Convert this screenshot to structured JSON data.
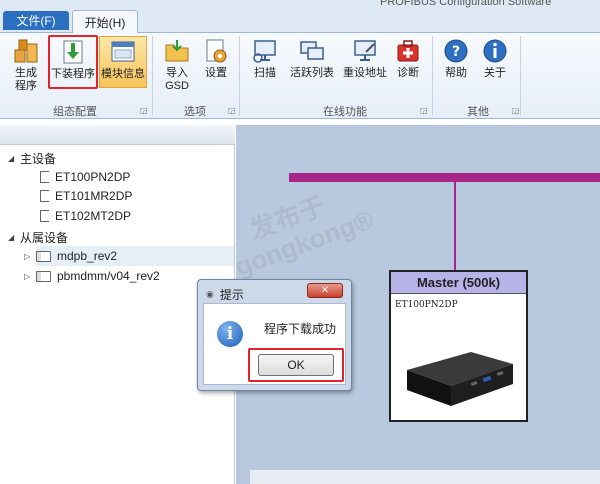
{
  "window": {
    "title": "PROFIBUS Configuration Software"
  },
  "menu": {
    "file_tab": "文件(F)",
    "home_tab": "开始(H)"
  },
  "ribbon": {
    "groups": [
      {
        "label": "组态配置",
        "buttons": [
          {
            "label": "生成\n程序",
            "icon": "generate-icon"
          },
          {
            "label": "下装程序",
            "icon": "download-icon"
          },
          {
            "label": "模块信息",
            "icon": "module-info-icon"
          }
        ]
      },
      {
        "label": "选项",
        "buttons": [
          {
            "label": "导入\nGSD",
            "icon": "folder-import-icon"
          },
          {
            "label": "设置",
            "icon": "settings-icon"
          }
        ]
      },
      {
        "label": "在线功能",
        "buttons": [
          {
            "label": "扫描",
            "icon": "scan-icon"
          },
          {
            "label": "活跃列表",
            "icon": "active-list-icon"
          },
          {
            "label": "重设地址",
            "icon": "reset-address-icon"
          },
          {
            "label": "诊断",
            "icon": "diagnose-icon"
          }
        ]
      },
      {
        "label": "其他",
        "buttons": [
          {
            "label": "帮助",
            "icon": "help-icon"
          },
          {
            "label": "关于",
            "icon": "about-icon"
          }
        ]
      }
    ]
  },
  "tree": {
    "master_label": "主设备",
    "masters": [
      "ET100PN2DP",
      "ET101MR2DP",
      "ET102MT2DP"
    ],
    "slave_label": "从属设备",
    "slaves": [
      "mdpb_rev2",
      "pbmdmm/v04_rev2"
    ]
  },
  "canvas": {
    "master_box_title": "Master (500k)",
    "master_box_device": "ET100PN2DP"
  },
  "watermark": {
    "line1": "发布于",
    "line2": "gongkong®"
  },
  "dialog": {
    "title": "提示",
    "message": "程序下载成功",
    "ok_label": "OK",
    "close_label": "✕"
  },
  "colors": {
    "accent": "#2b6fc0",
    "bus": "#a8268a",
    "highlight": "#e3242b",
    "canvas": "#b8c9df"
  }
}
